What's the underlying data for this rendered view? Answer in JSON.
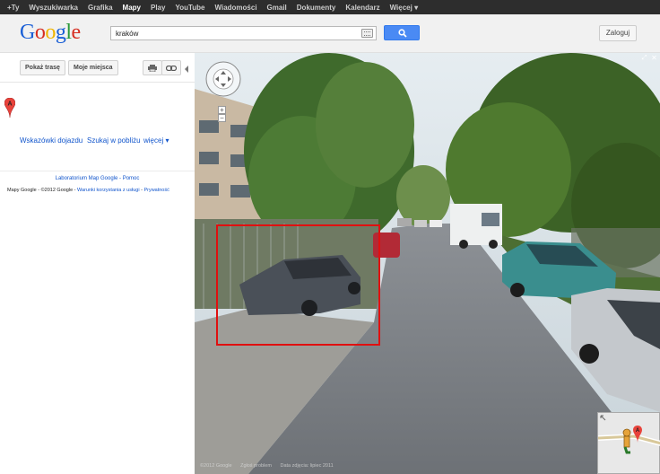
{
  "topbar": {
    "items": [
      {
        "label": "+Ty",
        "selected": false
      },
      {
        "label": "Wyszukiwarka",
        "selected": false
      },
      {
        "label": "Grafika",
        "selected": false
      },
      {
        "label": "Mapy",
        "selected": true
      },
      {
        "label": "Play",
        "selected": false
      },
      {
        "label": "YouTube",
        "selected": false
      },
      {
        "label": "Wiadomości",
        "selected": false
      },
      {
        "label": "Gmail",
        "selected": false
      },
      {
        "label": "Dokumenty",
        "selected": false
      },
      {
        "label": "Kalendarz",
        "selected": false
      },
      {
        "label": "Więcej ▾",
        "selected": false
      }
    ]
  },
  "header": {
    "logo_letters": [
      "G",
      "o",
      "o",
      "g",
      "l",
      "e"
    ],
    "logo_colors": [
      "#1a5fd6",
      "#d62d20",
      "#f0b400",
      "#1a5fd6",
      "#2a9a3a",
      "#d62d20"
    ],
    "search_value": "kraków",
    "signin_label": "Zaloguj"
  },
  "left_panel": {
    "show_route_label": "Pokaż trasę",
    "my_places_label": "Moje miejsca",
    "print_icon": "printer-icon",
    "link_icon": "link-icon",
    "pin_letter": "A",
    "directions_link": "Wskazówki dojazdu",
    "search_nearby_link": "Szukaj w pobliżu",
    "more_link": "więcej ▾",
    "footer_labs": "Laboratorium Map Google",
    "footer_help": "Pomoc",
    "footer_copyright": "Mapy Google - ©2012 Google -",
    "footer_terms": "Warunki korzystania z usługi",
    "footer_privacy": "Prywatność"
  },
  "streetview": {
    "zoom_in": "+",
    "zoom_out": "−",
    "fullscreen_icon": "expand-icon",
    "close_icon": "close-icon",
    "footer_copyright": "©2012 Google",
    "footer_terms": "Zgłoś problem",
    "footer_date": "Data zdjęcia: lipiec 2011",
    "accent_red": "#e01010"
  }
}
